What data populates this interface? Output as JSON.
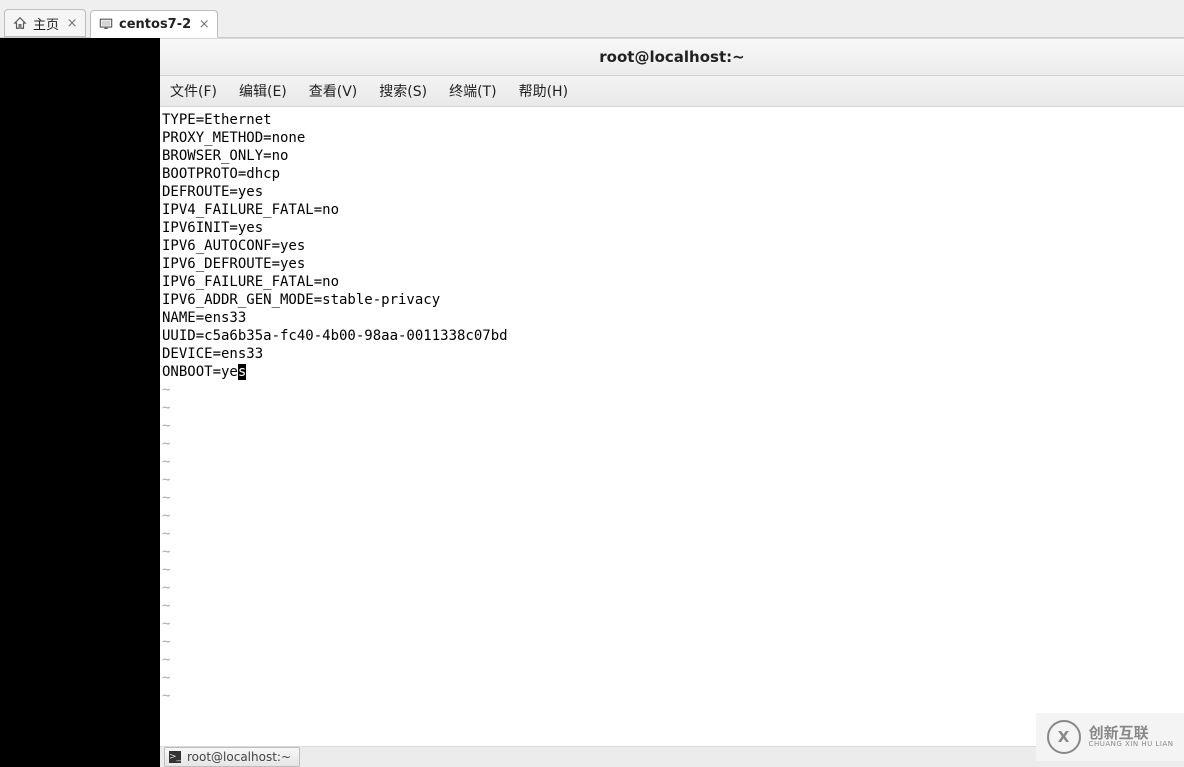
{
  "tabs": [
    {
      "label": "主页",
      "icon": "home-icon"
    },
    {
      "label": "centos7-2",
      "icon": "monitor-icon"
    }
  ],
  "window": {
    "title": "root@localhost:~"
  },
  "menu": {
    "file": "文件(F)",
    "edit": "编辑(E)",
    "view": "查看(V)",
    "search": "搜索(S)",
    "terminal": "终端(T)",
    "help": "帮助(H)"
  },
  "editor": {
    "lines": [
      "TYPE=Ethernet",
      "PROXY_METHOD=none",
      "BROWSER_ONLY=no",
      "BOOTPROTO=dhcp",
      "DEFROUTE=yes",
      "IPV4_FAILURE_FATAL=no",
      "IPV6INIT=yes",
      "IPV6_AUTOCONF=yes",
      "IPV6_DEFROUTE=yes",
      "IPV6_FAILURE_FATAL=no",
      "IPV6_ADDR_GEN_MODE=stable-privacy",
      "NAME=ens33",
      "UUID=c5a6b35a-fc40-4b00-98aa-0011338c07bd",
      "DEVICE=ens33"
    ],
    "last_line_prefix": "ONBOOT=ye",
    "last_line_cursor_char": "s",
    "tilde": "~",
    "tilde_count": 18
  },
  "taskbar": {
    "item_label": "root@localhost:~"
  },
  "watermark": {
    "big": "创新互联",
    "small": "CHUANG XIN HU LIAN",
    "icon_letter": "X"
  }
}
